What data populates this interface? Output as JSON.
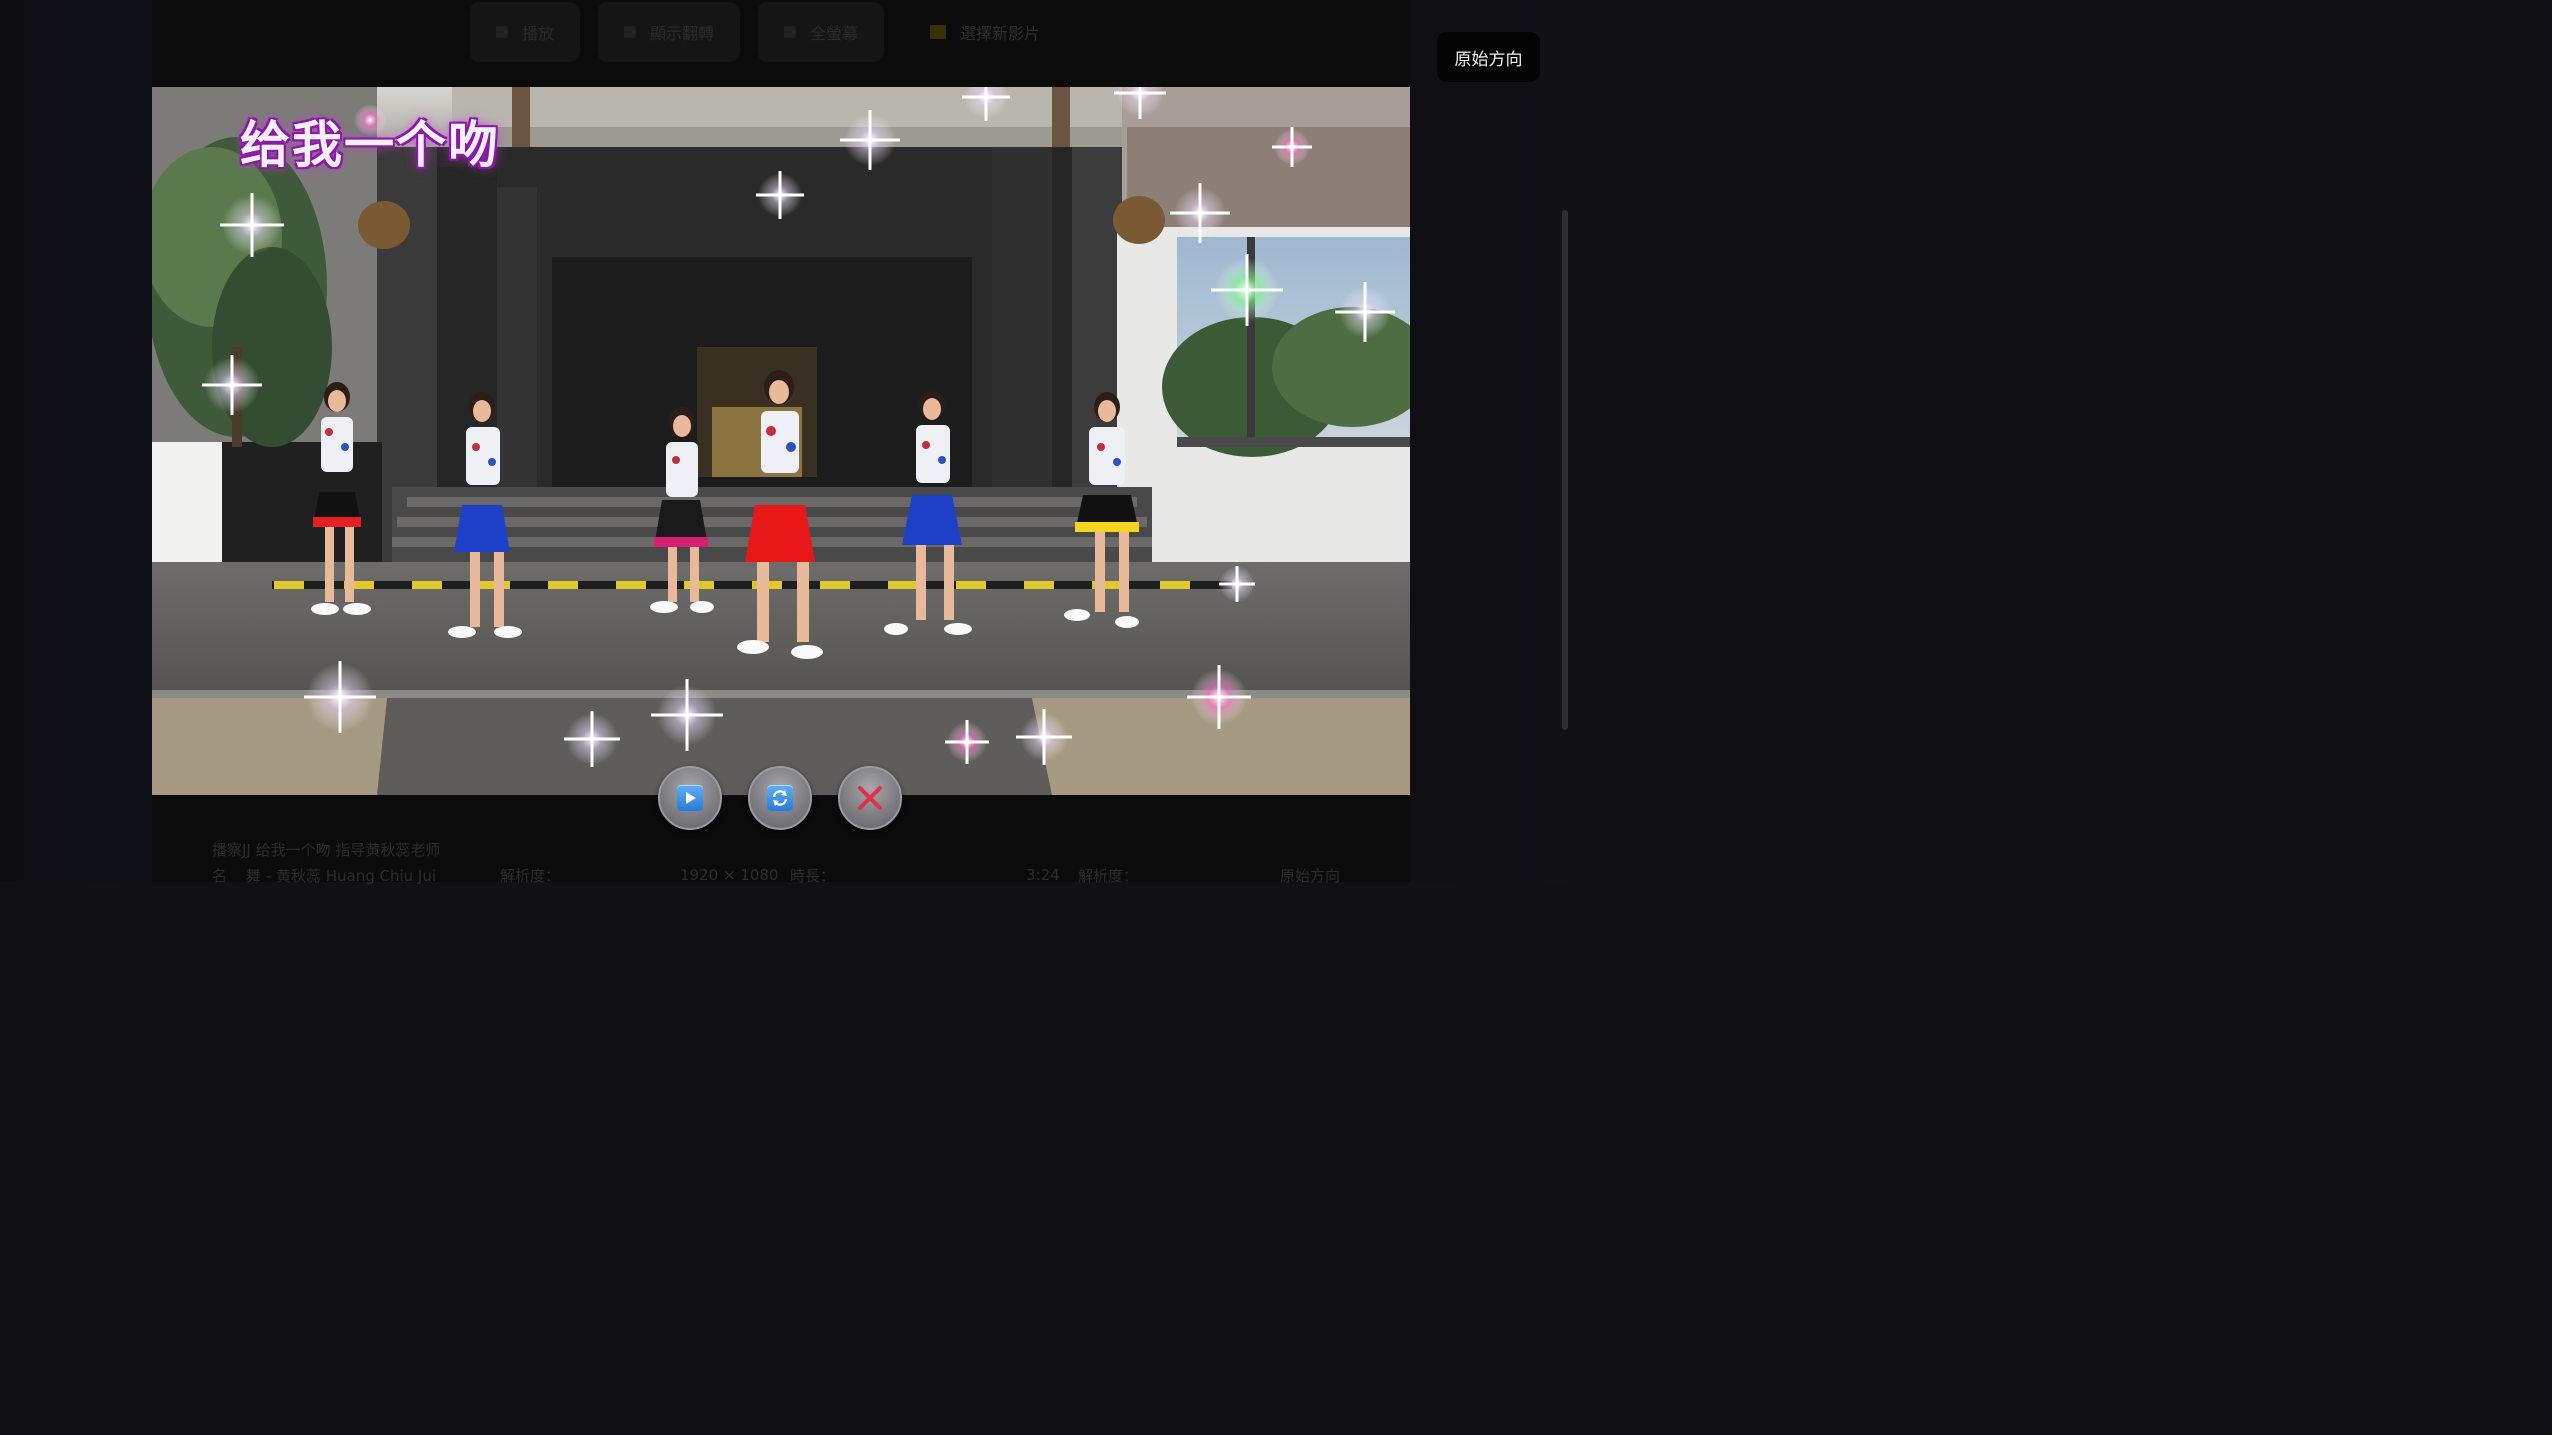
{
  "background_page": {
    "toolbar": {
      "play_label": "播放",
      "flip_label": "顯示翻轉",
      "fullscreen_label": "全螢幕",
      "select_label": "選擇新影片"
    },
    "info": {
      "file_name": "播察JJ 给我一个吻 指导黄秋蕊老师",
      "author_prefix": "名",
      "author": "舞 - 黄秋蕊 Huang Chiu Jui",
      "resolution_label": "解析度：",
      "resolution": "1920 × 1080",
      "duration_label": "時長：",
      "duration": "3:24",
      "orientation_label": "原始方向"
    }
  },
  "orientation_button": {
    "label": "原始方向"
  },
  "video": {
    "overlay_title": "给我一个吻"
  },
  "controls": {
    "play": "play-icon",
    "rotate": "rotate-icon",
    "close": "close-icon"
  },
  "colors": {
    "accent_blue": "#2a7ad8",
    "close_red": "#e0304a",
    "title_glow": "#8b1aa6"
  }
}
